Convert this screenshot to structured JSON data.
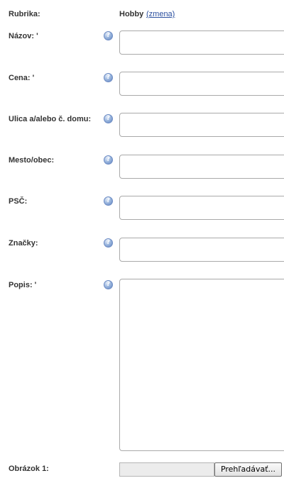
{
  "category": {
    "label": "Rubrika:",
    "value": "Hobby",
    "change_link": "(zmena)"
  },
  "help_icon": {
    "glyph": "?",
    "name": "help-icon"
  },
  "fields": [
    {
      "id": "name",
      "label": "Názov: '",
      "value": ""
    },
    {
      "id": "price",
      "label": "Cena: '",
      "value": ""
    },
    {
      "id": "street",
      "label": "Ulica a/alebo č. domu:",
      "value": ""
    },
    {
      "id": "city",
      "label": "Mesto/obec:",
      "value": ""
    },
    {
      "id": "zip",
      "label": "PSČ:",
      "value": ""
    },
    {
      "id": "tags",
      "label": "Značky:",
      "value": ""
    }
  ],
  "description": {
    "label": "Popis: '",
    "value": ""
  },
  "image_upload": {
    "label": "Obrázok 1:",
    "path_value": "",
    "browse_button": "Prehľadávať..."
  }
}
